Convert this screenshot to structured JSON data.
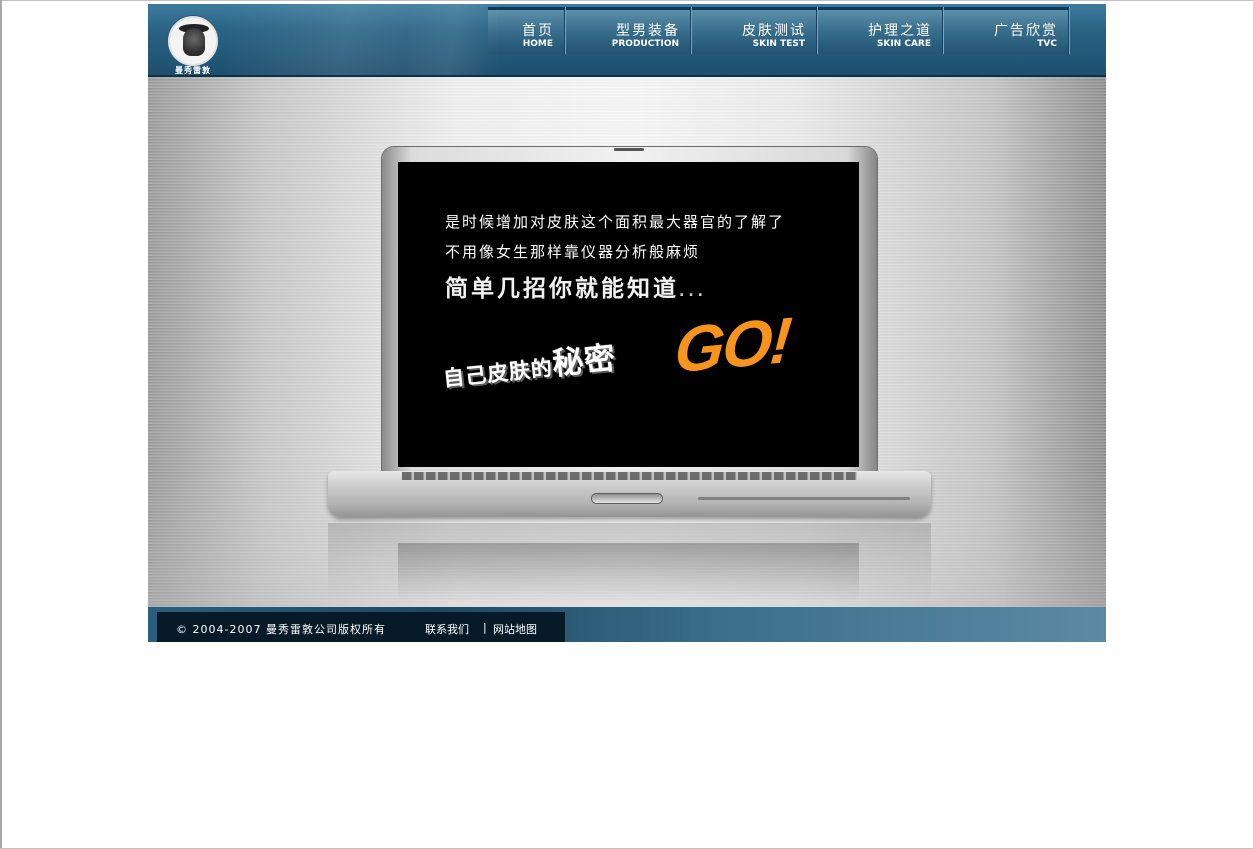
{
  "brand": {
    "name": "曼秀雷敦"
  },
  "nav": [
    {
      "cn": "首页",
      "en": "HOME"
    },
    {
      "cn": "型男装备",
      "en": "PRODUCTION"
    },
    {
      "cn": "皮肤测试",
      "en": "SKIN TEST"
    },
    {
      "cn": "护理之道",
      "en": "SKIN CARE"
    },
    {
      "cn": "广告欣赏",
      "en": "TVC"
    }
  ],
  "screen": {
    "line1": "是时候增加对皮肤这个面积最大器官的了解了",
    "line2": "不用像女生那样靠仪器分析般麻烦",
    "line3": "简单几招你就能知道",
    "line3_dots": "...",
    "line4_a": "自己皮肤的",
    "line4_b": "秘密",
    "go": "GO!"
  },
  "footer": {
    "copyright": "© 2004-2007 曼秀雷敦公司版权所有",
    "link_contact": "联系我们",
    "separator": "|",
    "link_sitemap": "网站地图"
  },
  "colors": {
    "header": "#2a6384",
    "go": "#f7941d",
    "footer_box": "#061a28"
  },
  "icons": {
    "logo": "mentholatum-badge-icon"
  }
}
